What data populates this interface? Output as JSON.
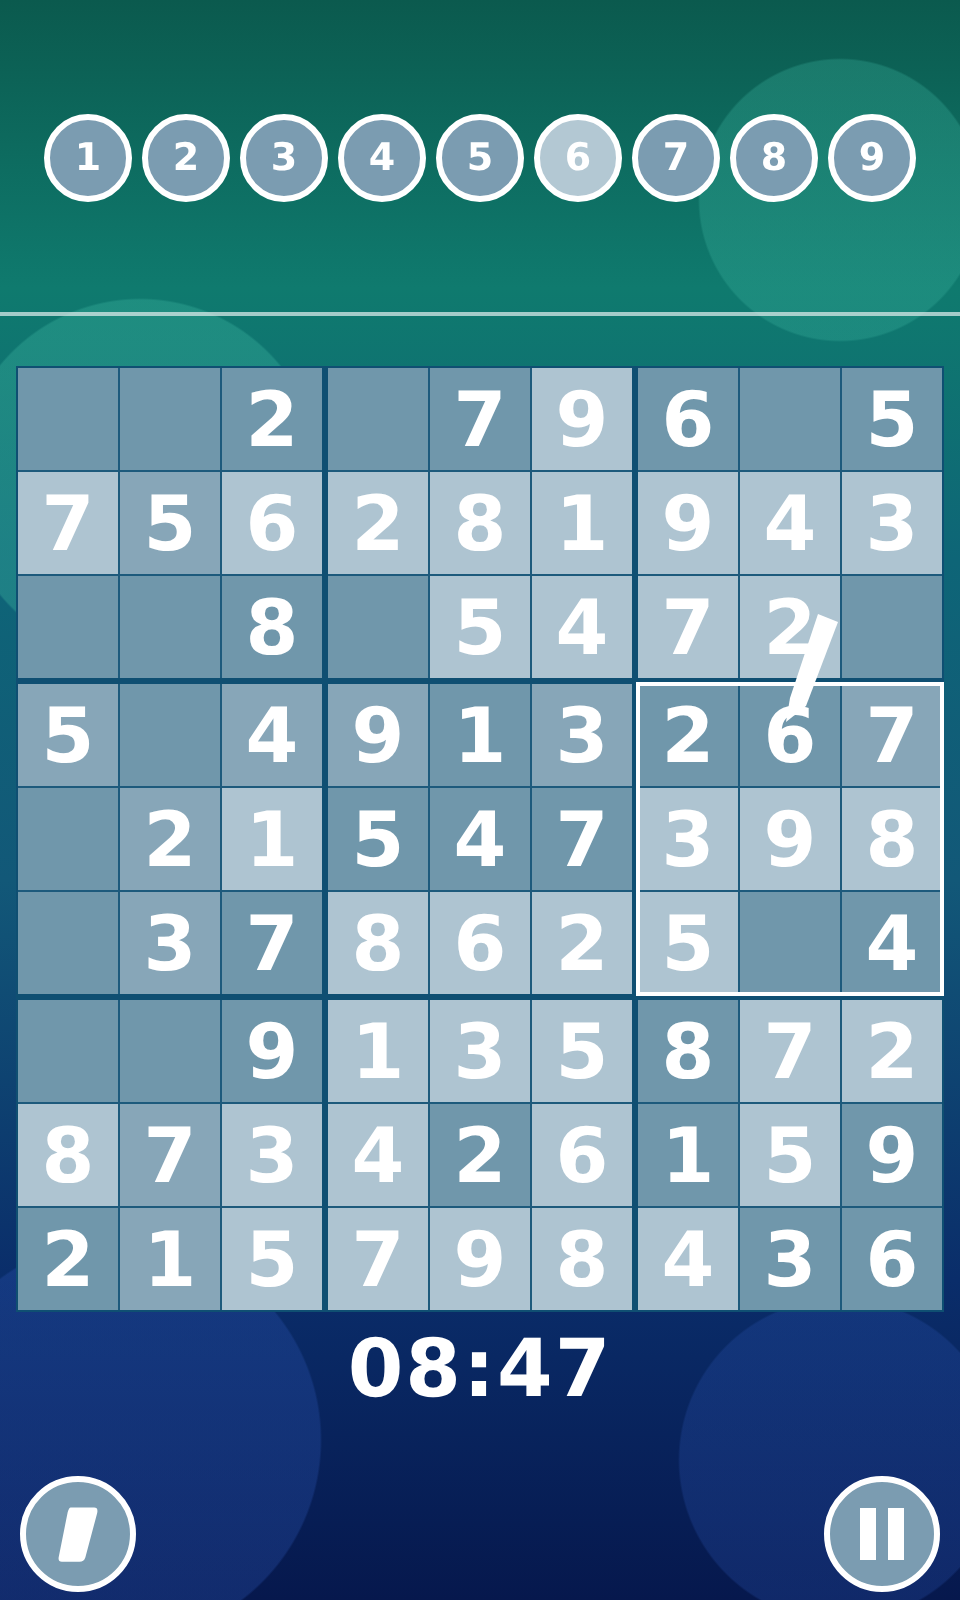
{
  "number_buttons": [
    {
      "label": "1",
      "selected": false
    },
    {
      "label": "2",
      "selected": false
    },
    {
      "label": "3",
      "selected": false
    },
    {
      "label": "4",
      "selected": false
    },
    {
      "label": "5",
      "selected": false
    },
    {
      "label": "6",
      "selected": true
    },
    {
      "label": "7",
      "selected": false
    },
    {
      "label": "8",
      "selected": false
    },
    {
      "label": "9",
      "selected": false
    }
  ],
  "blocks": [
    {
      "selected": false,
      "cells": [
        {
          "highlighted": false,
          "tinted": false
        },
        {
          "highlighted": false,
          "tinted": false
        },
        {
          "value": "2",
          "highlighted": false,
          "tinted": false
        },
        {
          "value": "7",
          "highlighted": true,
          "tinted": false
        },
        {
          "value": "5",
          "highlighted": false,
          "tinted": true
        },
        {
          "value": "6",
          "highlighted": true,
          "tinted": false
        },
        {
          "highlighted": false,
          "tinted": false
        },
        {
          "highlighted": false,
          "tinted": false
        },
        {
          "value": "8",
          "highlighted": false,
          "tinted": false
        }
      ]
    },
    {
      "selected": false,
      "cells": [
        {
          "highlighted": false,
          "tinted": false
        },
        {
          "value": "7",
          "highlighted": false,
          "tinted": false
        },
        {
          "value": "9",
          "highlighted": true,
          "tinted": false
        },
        {
          "value": "2",
          "highlighted": true,
          "tinted": false
        },
        {
          "value": "8",
          "highlighted": true,
          "tinted": false
        },
        {
          "value": "1",
          "highlighted": true,
          "tinted": false
        },
        {
          "highlighted": false,
          "tinted": false
        },
        {
          "value": "5",
          "highlighted": true,
          "tinted": false
        },
        {
          "value": "4",
          "highlighted": true,
          "tinted": false
        }
      ]
    },
    {
      "selected": false,
      "cells": [
        {
          "value": "6",
          "highlighted": false,
          "tinted": false
        },
        {
          "highlighted": false,
          "tinted": false
        },
        {
          "value": "5",
          "highlighted": false,
          "tinted": false
        },
        {
          "value": "9",
          "highlighted": true,
          "tinted": false
        },
        {
          "value": "4",
          "highlighted": true,
          "tinted": false
        },
        {
          "value": "3",
          "highlighted": true,
          "tinted": false
        },
        {
          "value": "7",
          "highlighted": true,
          "tinted": false
        },
        {
          "value": "2",
          "highlighted": true,
          "tinted": false
        },
        {
          "highlighted": false,
          "tinted": false
        }
      ]
    },
    {
      "selected": false,
      "cells": [
        {
          "value": "5",
          "highlighted": false,
          "tinted": true
        },
        {
          "highlighted": false,
          "tinted": false
        },
        {
          "value": "4",
          "highlighted": false,
          "tinted": true
        },
        {
          "highlighted": false,
          "tinted": false
        },
        {
          "value": "2",
          "highlighted": false,
          "tinted": true
        },
        {
          "value": "1",
          "highlighted": true,
          "tinted": false
        },
        {
          "highlighted": false,
          "tinted": false
        },
        {
          "value": "3",
          "highlighted": false,
          "tinted": true
        },
        {
          "value": "7",
          "highlighted": false,
          "tinted": false
        }
      ]
    },
    {
      "selected": false,
      "cells": [
        {
          "value": "9",
          "highlighted": false,
          "tinted": true
        },
        {
          "value": "1",
          "highlighted": false,
          "tinted": false
        },
        {
          "value": "3",
          "highlighted": false,
          "tinted": true
        },
        {
          "value": "5",
          "highlighted": false,
          "tinted": false
        },
        {
          "value": "4",
          "highlighted": false,
          "tinted": false
        },
        {
          "value": "7",
          "highlighted": false,
          "tinted": false
        },
        {
          "value": "8",
          "highlighted": true,
          "tinted": false
        },
        {
          "value": "6",
          "highlighted": true,
          "tinted": false
        },
        {
          "value": "2",
          "highlighted": true,
          "tinted": false
        }
      ]
    },
    {
      "selected": true,
      "cells": [
        {
          "value": "2",
          "highlighted": false,
          "tinted": false
        },
        {
          "value": "6",
          "highlighted": false,
          "tinted": false
        },
        {
          "value": "7",
          "highlighted": false,
          "tinted": true
        },
        {
          "value": "3",
          "highlighted": true,
          "tinted": false
        },
        {
          "value": "9",
          "highlighted": true,
          "tinted": false
        },
        {
          "value": "8",
          "highlighted": true,
          "tinted": false
        },
        {
          "value": "5",
          "highlighted": true,
          "tinted": false
        },
        {
          "highlighted": false,
          "tinted": false
        },
        {
          "value": "4",
          "highlighted": false,
          "tinted": false
        }
      ]
    },
    {
      "selected": false,
      "cells": [
        {
          "highlighted": false,
          "tinted": false
        },
        {
          "highlighted": false,
          "tinted": false
        },
        {
          "value": "9",
          "highlighted": false,
          "tinted": false
        },
        {
          "value": "8",
          "highlighted": true,
          "tinted": false
        },
        {
          "value": "7",
          "highlighted": false,
          "tinted": true
        },
        {
          "value": "3",
          "highlighted": true,
          "tinted": false
        },
        {
          "value": "2",
          "highlighted": false,
          "tinted": false
        },
        {
          "value": "1",
          "highlighted": false,
          "tinted": true
        },
        {
          "value": "5",
          "highlighted": true,
          "tinted": false
        }
      ]
    },
    {
      "selected": false,
      "cells": [
        {
          "value": "1",
          "highlighted": true,
          "tinted": false
        },
        {
          "value": "3",
          "highlighted": true,
          "tinted": false
        },
        {
          "value": "5",
          "highlighted": true,
          "tinted": false
        },
        {
          "value": "4",
          "highlighted": true,
          "tinted": false
        },
        {
          "value": "2",
          "highlighted": false,
          "tinted": false
        },
        {
          "value": "6",
          "highlighted": true,
          "tinted": false
        },
        {
          "value": "7",
          "highlighted": true,
          "tinted": false
        },
        {
          "value": "9",
          "highlighted": true,
          "tinted": false
        },
        {
          "value": "8",
          "highlighted": true,
          "tinted": false
        }
      ]
    },
    {
      "selected": false,
      "cells": [
        {
          "value": "8",
          "highlighted": false,
          "tinted": false
        },
        {
          "value": "7",
          "highlighted": true,
          "tinted": false
        },
        {
          "value": "2",
          "highlighted": true,
          "tinted": false
        },
        {
          "value": "1",
          "highlighted": false,
          "tinted": false
        },
        {
          "value": "5",
          "highlighted": true,
          "tinted": false
        },
        {
          "value": "9",
          "highlighted": false,
          "tinted": false
        },
        {
          "value": "4",
          "highlighted": true,
          "tinted": false
        },
        {
          "value": "3",
          "highlighted": false,
          "tinted": false
        },
        {
          "value": "6",
          "highlighted": false,
          "tinted": false
        }
      ]
    }
  ],
  "timer": "08:47"
}
